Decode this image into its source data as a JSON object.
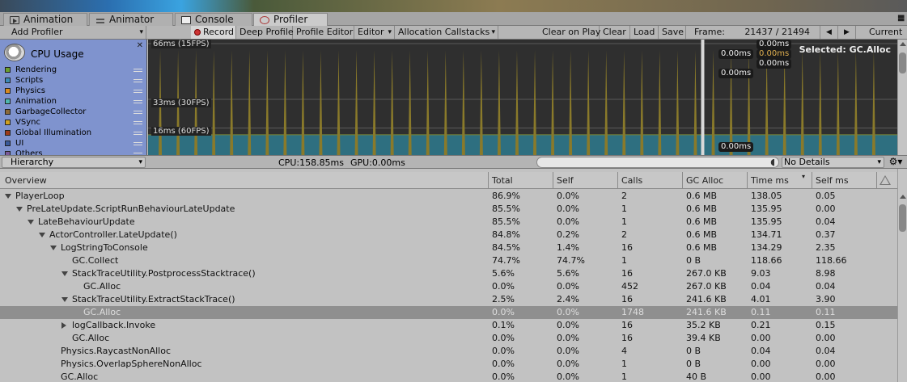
{
  "tabs": [
    {
      "label": "Animation",
      "icon": "animation-icon",
      "active": false
    },
    {
      "label": "Animator",
      "icon": "animator-icon",
      "active": false
    },
    {
      "label": "Console",
      "icon": "console-icon",
      "active": false
    },
    {
      "label": "Profiler",
      "icon": "profiler-icon",
      "active": true
    }
  ],
  "toolbar": {
    "add_profiler": "Add Profiler",
    "record": "Record",
    "deep_profile": "Deep Profile",
    "profile_editor": "Profile Editor",
    "editor": "Editor",
    "allocation_callstacks": "Allocation Callstacks",
    "clear_on_play": "Clear on Play",
    "clear": "Clear",
    "load": "Load",
    "save": "Save",
    "frame_label": "Frame:",
    "frame_value": "21437 / 21494",
    "prev_frame": "◀",
    "next_frame": "▶",
    "current": "Current"
  },
  "cpu_panel": {
    "title": "CPU Usage",
    "close": "✕",
    "legend": [
      {
        "label": "Rendering",
        "color": "#6a9e2f"
      },
      {
        "label": "Scripts",
        "color": "#3d8ab8"
      },
      {
        "label": "Physics",
        "color": "#d98a1f"
      },
      {
        "label": "Animation",
        "color": "#4fb8b0"
      },
      {
        "label": "GarbageCollector",
        "color": "#8c6a3a"
      },
      {
        "label": "VSync",
        "color": "#d0a020"
      },
      {
        "label": "Global Illumination",
        "color": "#9c3a1a"
      },
      {
        "label": "UI",
        "color": "#3a5a9a"
      },
      {
        "label": "Others",
        "color": "#7a5a9a"
      }
    ]
  },
  "chart": {
    "fps_labels": [
      "66ms (15FPS)",
      "33ms (30FPS)",
      "16ms (60FPS)"
    ],
    "ms_tags": [
      "0.00ms",
      "0.00ms",
      "0.00ms",
      "0.00ms",
      "0.00ms",
      "0.00ms"
    ],
    "selected": "Selected: GC.Alloc"
  },
  "chart_data": {
    "type": "area",
    "title": "CPU Usage",
    "xlabel": "",
    "ylabel": "",
    "ylim": [
      0,
      66
    ],
    "reference_lines": [
      {
        "label": "66ms (15FPS)",
        "value": 66
      },
      {
        "label": "33ms (30FPS)",
        "value": 33
      },
      {
        "label": "16ms (60FPS)",
        "value": 16
      }
    ],
    "baseline_ms": 12,
    "spike_frames": [
      1,
      3,
      5,
      7,
      9,
      11,
      13,
      15,
      17,
      19,
      21,
      23,
      25,
      27,
      29,
      31,
      33,
      35,
      37,
      39,
      41,
      43,
      45,
      47,
      49,
      51,
      53,
      55,
      57,
      59,
      61,
      63,
      65,
      67,
      69,
      71,
      73,
      75,
      77,
      79,
      81
    ],
    "spike_ms": 62,
    "frame_count": 84,
    "selected_frame": 62
  },
  "hierarchy_bar": {
    "view": "Hierarchy",
    "cpu": "CPU:158.85ms",
    "gpu": "GPU:0.00ms",
    "search_placeholder": "",
    "details": "No Details",
    "gear": "⚙▾"
  },
  "table": {
    "columns": [
      "Overview",
      "Total",
      "Self",
      "Calls",
      "GC Alloc",
      "Time ms",
      "Self ms"
    ],
    "rows": [
      {
        "name": "PlayerLoop",
        "depth": 0,
        "fold": "open",
        "total": "86.9%",
        "self": "0.0%",
        "calls": "2",
        "gc": "0.6 MB",
        "time": "138.05",
        "selfms": "0.05"
      },
      {
        "name": "PreLateUpdate.ScriptRunBehaviourLateUpdate",
        "depth": 1,
        "fold": "open",
        "total": "85.5%",
        "self": "0.0%",
        "calls": "1",
        "gc": "0.6 MB",
        "time": "135.95",
        "selfms": "0.00"
      },
      {
        "name": "LateBehaviourUpdate",
        "depth": 2,
        "fold": "open",
        "total": "85.5%",
        "self": "0.0%",
        "calls": "1",
        "gc": "0.6 MB",
        "time": "135.95",
        "selfms": "0.04"
      },
      {
        "name": "ActorController.LateUpdate()",
        "depth": 3,
        "fold": "open",
        "total": "84.8%",
        "self": "0.2%",
        "calls": "2",
        "gc": "0.6 MB",
        "time": "134.71",
        "selfms": "0.37"
      },
      {
        "name": "LogStringToConsole",
        "depth": 4,
        "fold": "open",
        "total": "84.5%",
        "self": "1.4%",
        "calls": "16",
        "gc": "0.6 MB",
        "time": "134.29",
        "selfms": "2.35"
      },
      {
        "name": "GC.Collect",
        "depth": 5,
        "fold": "none",
        "total": "74.7%",
        "self": "74.7%",
        "calls": "1",
        "gc": "0 B",
        "time": "118.66",
        "selfms": "118.66"
      },
      {
        "name": "StackTraceUtility.PostprocessStacktrace()",
        "depth": 5,
        "fold": "open",
        "total": "5.6%",
        "self": "5.6%",
        "calls": "16",
        "gc": "267.0 KB",
        "time": "9.03",
        "selfms": "8.98"
      },
      {
        "name": "GC.Alloc",
        "depth": 6,
        "fold": "none",
        "total": "0.0%",
        "self": "0.0%",
        "calls": "452",
        "gc": "267.0 KB",
        "time": "0.04",
        "selfms": "0.04"
      },
      {
        "name": "StackTraceUtility.ExtractStackTrace()",
        "depth": 5,
        "fold": "open",
        "total": "2.5%",
        "self": "2.4%",
        "calls": "16",
        "gc": "241.6 KB",
        "time": "4.01",
        "selfms": "3.90"
      },
      {
        "name": "GC.Alloc",
        "depth": 6,
        "fold": "none",
        "total": "0.0%",
        "self": "0.0%",
        "calls": "1748",
        "gc": "241.6 KB",
        "time": "0.11",
        "selfms": "0.11",
        "selected": true
      },
      {
        "name": "logCallback.Invoke",
        "depth": 5,
        "fold": "closed",
        "total": "0.1%",
        "self": "0.0%",
        "calls": "16",
        "gc": "35.2 KB",
        "time": "0.21",
        "selfms": "0.15"
      },
      {
        "name": "GC.Alloc",
        "depth": 5,
        "fold": "none",
        "total": "0.0%",
        "self": "0.0%",
        "calls": "16",
        "gc": "39.4 KB",
        "time": "0.00",
        "selfms": "0.00"
      },
      {
        "name": "Physics.RaycastNonAlloc",
        "depth": 4,
        "fold": "none",
        "total": "0.0%",
        "self": "0.0%",
        "calls": "4",
        "gc": "0 B",
        "time": "0.04",
        "selfms": "0.04"
      },
      {
        "name": "Physics.OverlapSphereNonAlloc",
        "depth": 4,
        "fold": "none",
        "total": "0.0%",
        "self": "0.0%",
        "calls": "1",
        "gc": "0 B",
        "time": "0.00",
        "selfms": "0.00"
      },
      {
        "name": "GC.Alloc",
        "depth": 4,
        "fold": "none",
        "total": "0.0%",
        "self": "0.0%",
        "calls": "1",
        "gc": "40 B",
        "time": "0.00",
        "selfms": "0.00"
      }
    ]
  }
}
